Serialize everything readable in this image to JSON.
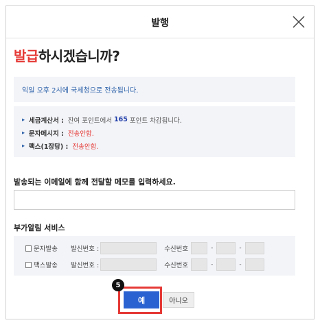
{
  "dialog": {
    "title": "발행",
    "close_icon": "close-icon"
  },
  "heading": {
    "accent": "발급",
    "rest": "하시겠습니까?"
  },
  "notice": "익일 오후 2시에 국세청으로 전송됩니다.",
  "details": [
    {
      "label": "세금계산서 :",
      "before": "잔여 포인트에서",
      "number": "165",
      "after": "포인트 차감됩니다."
    },
    {
      "label": "문자메시지 :",
      "value": "전송안함."
    },
    {
      "label": "팩스(1장당) :",
      "value": "전송안함."
    }
  ],
  "memo": {
    "label": "발송되는 이메일에 함께 전달할 메모를 입력하세요.",
    "value": "",
    "placeholder": ""
  },
  "alert_service": {
    "label": "부가알림 서비스",
    "rows": [
      {
        "name": "문자발송",
        "sender_label": "발신번호 :",
        "receiver_label": "수신번호",
        "checked": false
      },
      {
        "name": "팩스발송",
        "sender_label": "발신번호 :",
        "receiver_label": "수신번호",
        "checked": false
      }
    ],
    "separator": "-"
  },
  "buttons": {
    "yes": "예",
    "no": "아니오"
  },
  "step_badge": "5",
  "colors": {
    "accent_red": "#e53935",
    "primary_blue": "#2a62d1",
    "panel_bg": "#f3f4f8"
  }
}
